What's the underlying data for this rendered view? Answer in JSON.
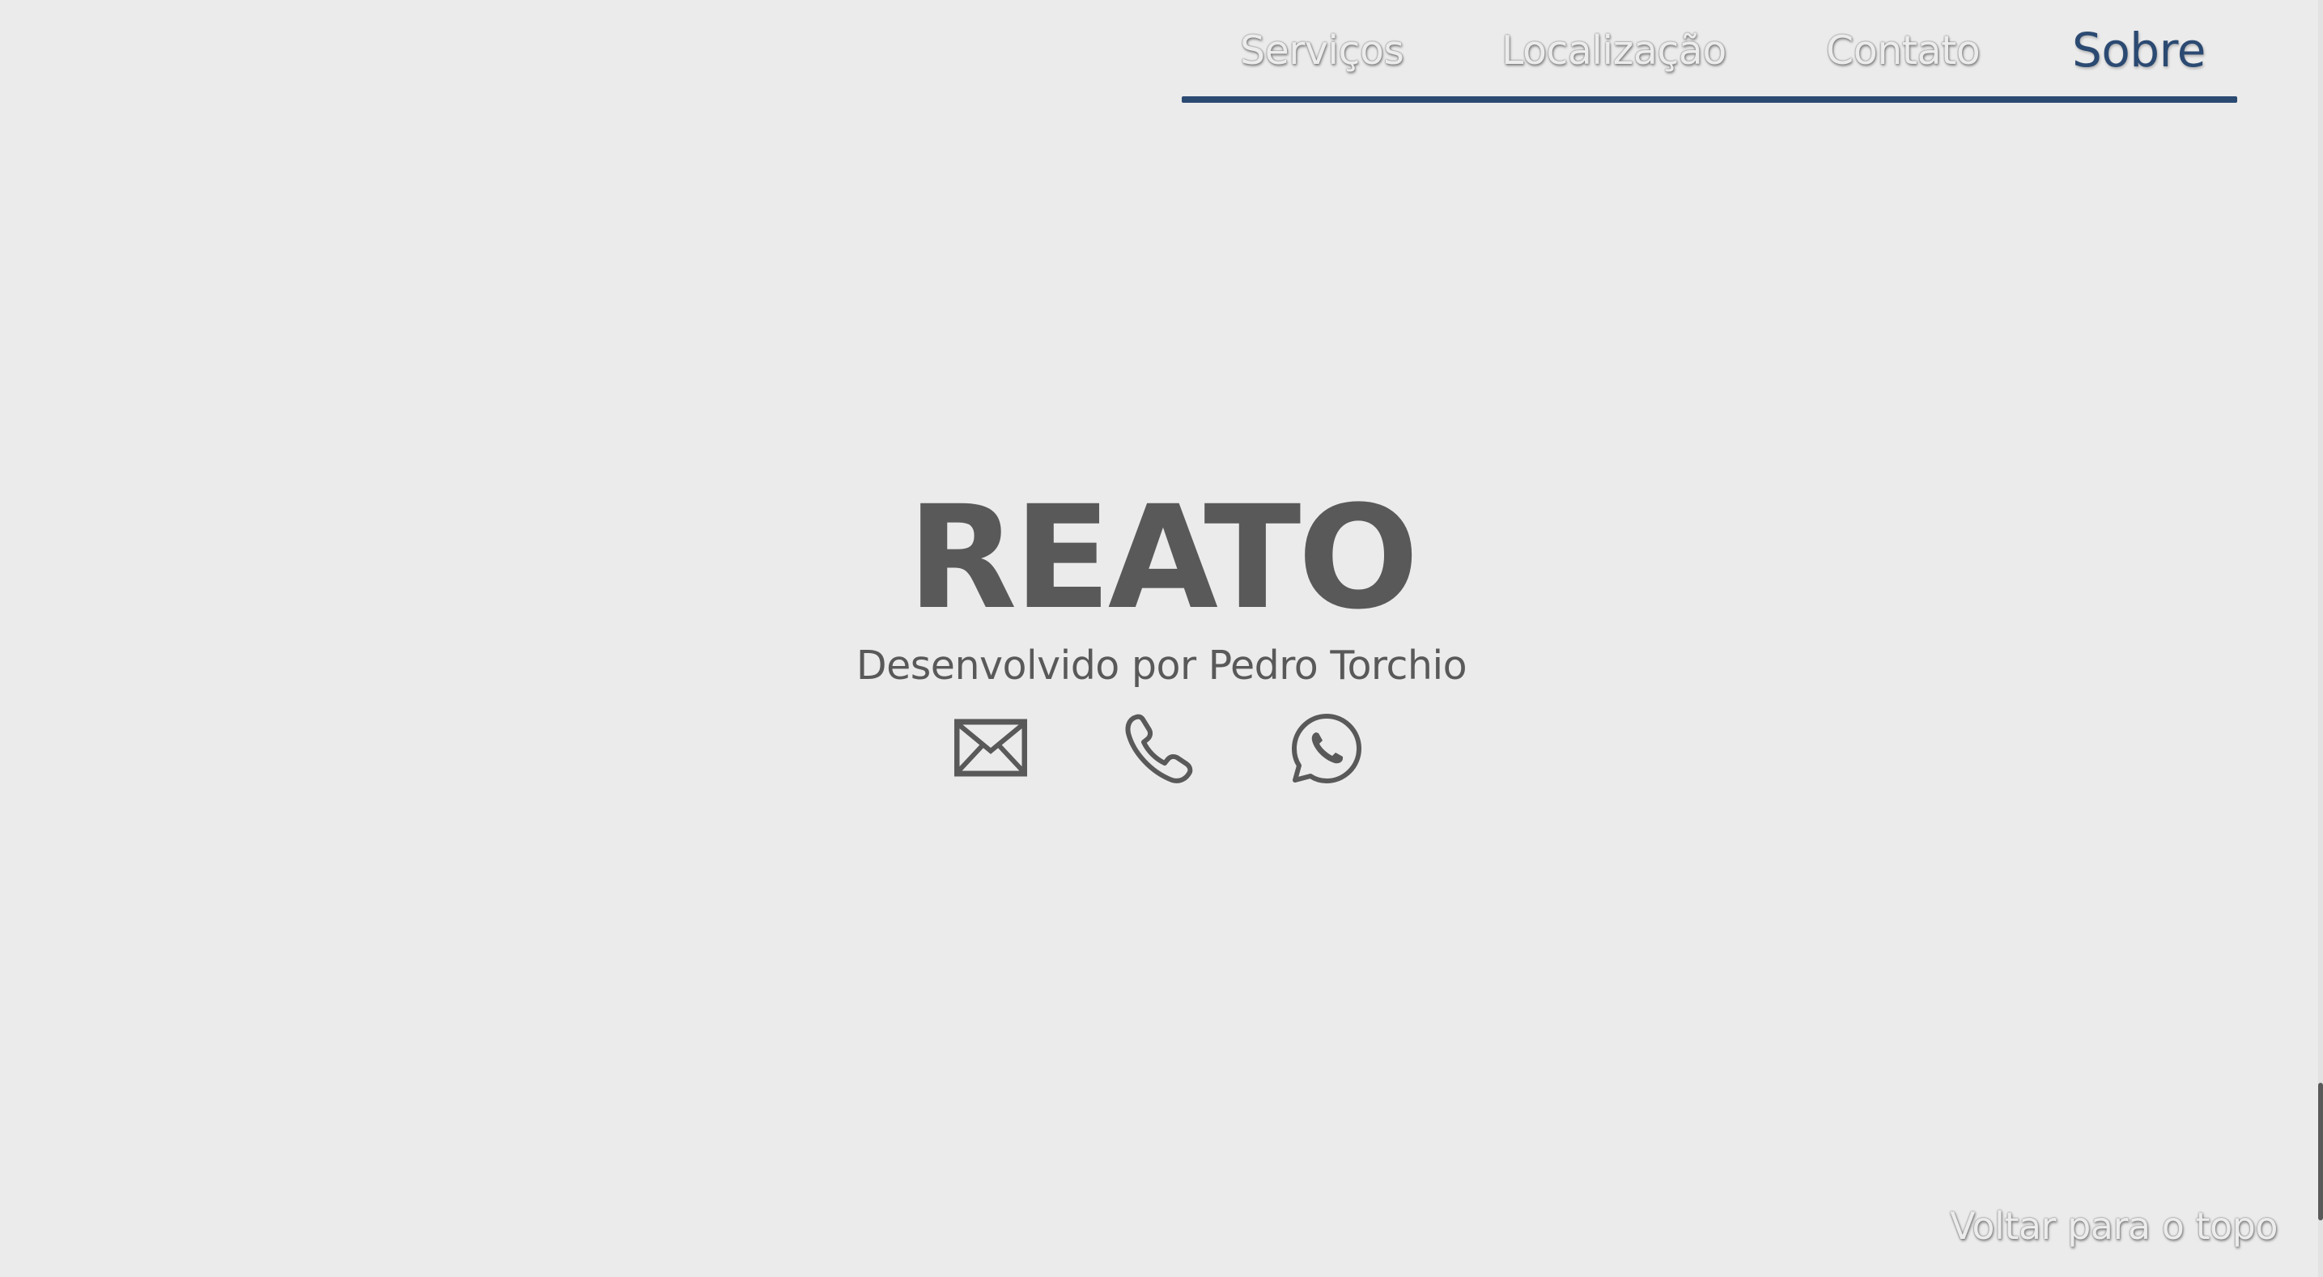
{
  "nav": {
    "items": [
      {
        "label": "Serviços",
        "active": false
      },
      {
        "label": "Localização",
        "active": false
      },
      {
        "label": "Contato",
        "active": false
      },
      {
        "label": "Sobre",
        "active": true
      }
    ],
    "accent_color": "#2b4a72",
    "inactive_color": "#ececec"
  },
  "footer": {
    "brand": "REATO",
    "credits": "Desenvolvido por Pedro Torchio",
    "contact_icons": [
      "envelope-icon",
      "phone-icon",
      "whatsapp-icon"
    ],
    "text_color": "#595959"
  },
  "back_to_top": {
    "label": "Voltar para o topo"
  },
  "scroll": {
    "position_fraction": 0.95
  },
  "background_color": "#ebebeb"
}
